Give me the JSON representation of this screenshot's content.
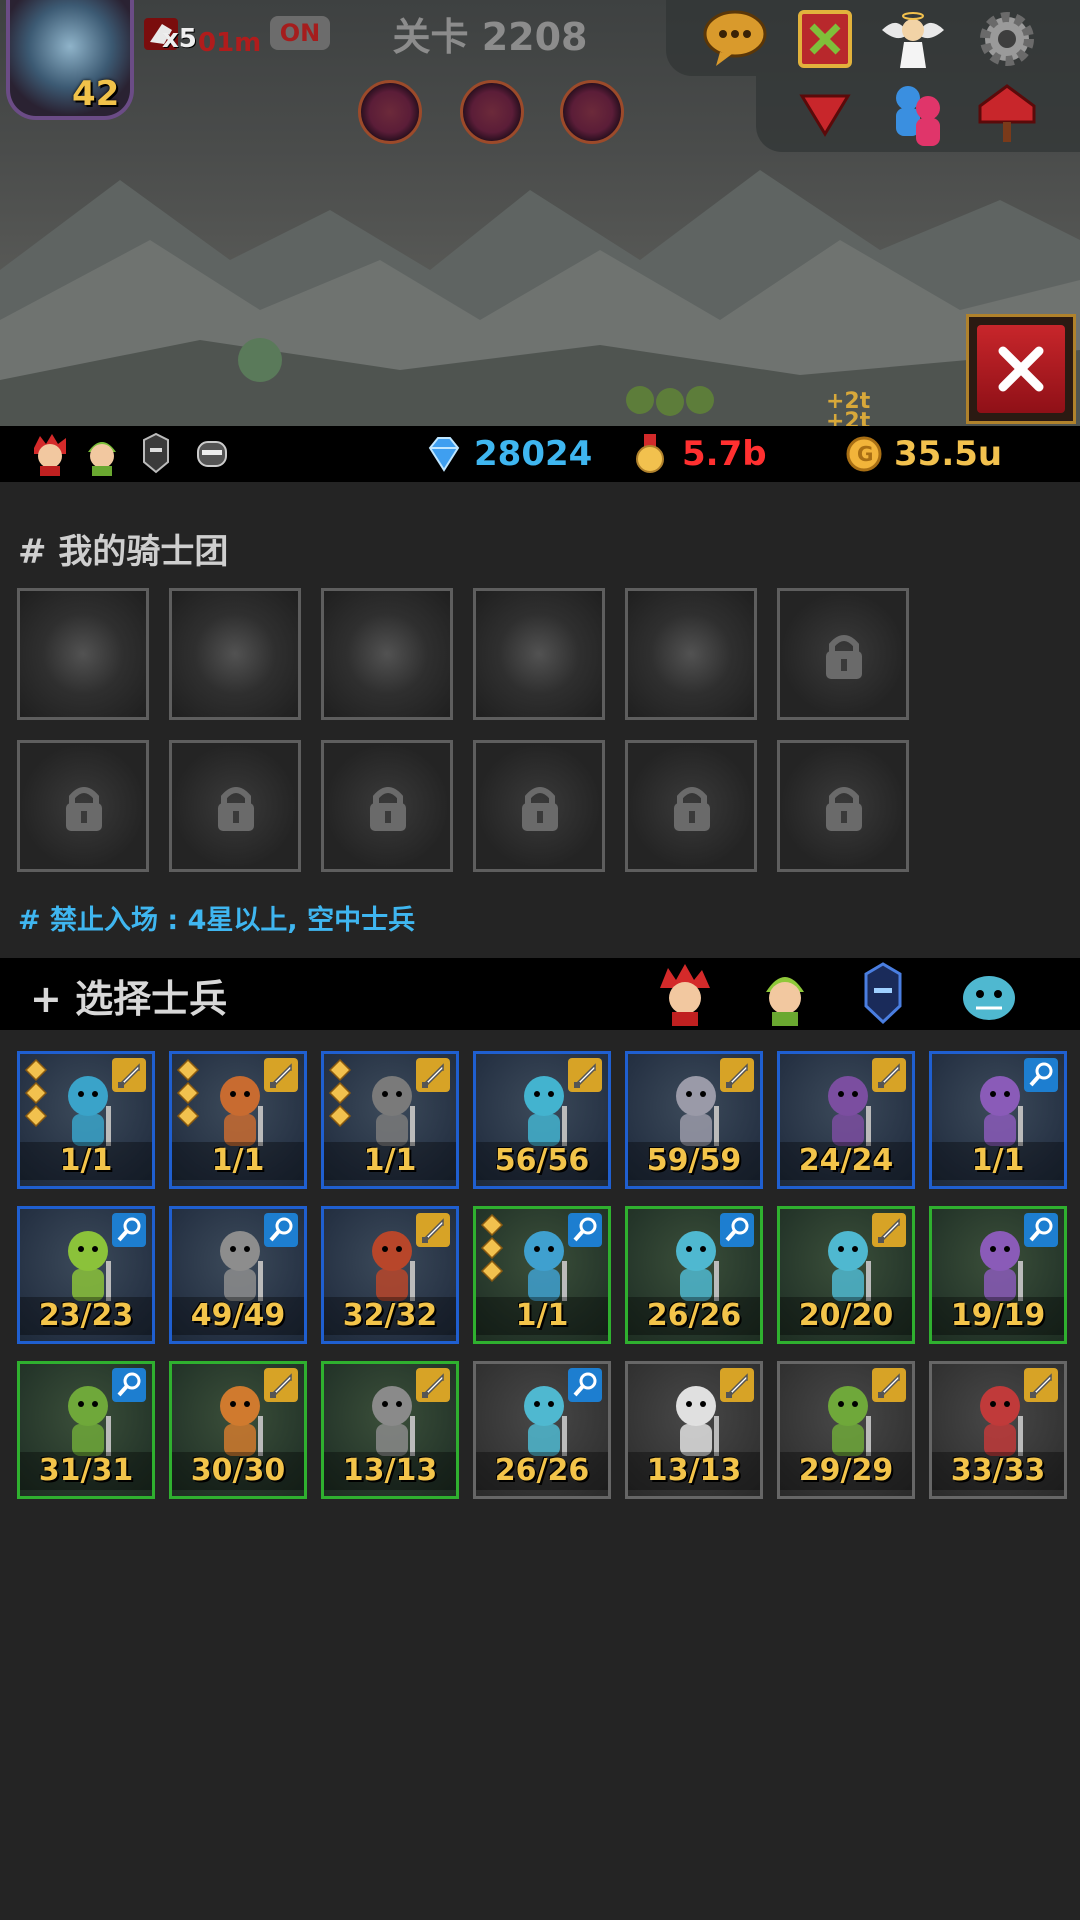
{
  "top": {
    "hero_level": "42",
    "boost_multiplier": "x5",
    "boost_time": "01m",
    "auto_toggle": "ON",
    "stage_label": "关卡 2208",
    "gold_float": "+2t\n+2t"
  },
  "resources": {
    "gems": "28024",
    "medals": "5.7b",
    "gold": "35.5u"
  },
  "team": {
    "title": "# 我的骑士团",
    "ban_text": "# 禁止入场 : 4星以上, 空中士兵"
  },
  "select": {
    "title": "+ 选择士兵"
  },
  "colors": {
    "gem": "#3fb6f0",
    "medal": "#ff3030",
    "gold": "#f2c14e",
    "ban": "#3fb6f0"
  },
  "soldiers": [
    {
      "count": "1/1",
      "frame": "blue",
      "badge": "sword",
      "stars": true,
      "body": "#3aa3c9"
    },
    {
      "count": "1/1",
      "frame": "blue",
      "badge": "sword",
      "stars": true,
      "body": "#c86b30"
    },
    {
      "count": "1/1",
      "frame": "blue",
      "badge": "sword",
      "stars": true,
      "body": "#7a7a7a"
    },
    {
      "count": "56/56",
      "frame": "blue",
      "badge": "sword",
      "stars": false,
      "body": "#43b3cf"
    },
    {
      "count": "59/59",
      "frame": "blue",
      "badge": "sword",
      "stars": false,
      "body": "#9a9aa8"
    },
    {
      "count": "24/24",
      "frame": "blue",
      "badge": "sword",
      "stars": false,
      "body": "#7b4ea0"
    },
    {
      "count": "1/1",
      "frame": "blue",
      "badge": "magic",
      "stars": false,
      "body": "#8a5bb8"
    },
    {
      "count": "23/23",
      "frame": "blue",
      "badge": "magic",
      "stars": false,
      "body": "#8bc23a"
    },
    {
      "count": "49/49",
      "frame": "blue",
      "badge": "magic",
      "stars": false,
      "body": "#8d8d8d"
    },
    {
      "count": "32/32",
      "frame": "blue",
      "badge": "sword",
      "stars": false,
      "body": "#b8462a"
    },
    {
      "count": "1/1",
      "frame": "green",
      "badge": "magic",
      "stars": true,
      "body": "#3fa0cf"
    },
    {
      "count": "26/26",
      "frame": "green",
      "badge": "magic",
      "stars": false,
      "body": "#4fb8d0"
    },
    {
      "count": "20/20",
      "frame": "green",
      "badge": "sword",
      "stars": false,
      "body": "#4fb8d0"
    },
    {
      "count": "19/19",
      "frame": "green",
      "badge": "magic",
      "stars": false,
      "body": "#8a5bb8"
    },
    {
      "count": "31/31",
      "frame": "green",
      "badge": "magic",
      "stars": false,
      "body": "#6fa83a"
    },
    {
      "count": "30/30",
      "frame": "green",
      "badge": "sword",
      "stars": false,
      "body": "#d07a2e"
    },
    {
      "count": "13/13",
      "frame": "green",
      "badge": "sword",
      "stars": false,
      "body": "#8a8a8a"
    },
    {
      "count": "26/26",
      "frame": "gray",
      "badge": "magic",
      "stars": false,
      "body": "#4fb8d0"
    },
    {
      "count": "13/13",
      "frame": "gray",
      "badge": "sword",
      "stars": false,
      "body": "#e0e0e0"
    },
    {
      "count": "29/29",
      "frame": "gray",
      "badge": "sword",
      "stars": false,
      "body": "#6fa83a"
    },
    {
      "count": "33/33",
      "frame": "gray",
      "badge": "sword",
      "stars": false,
      "body": "#c03a3a"
    }
  ]
}
